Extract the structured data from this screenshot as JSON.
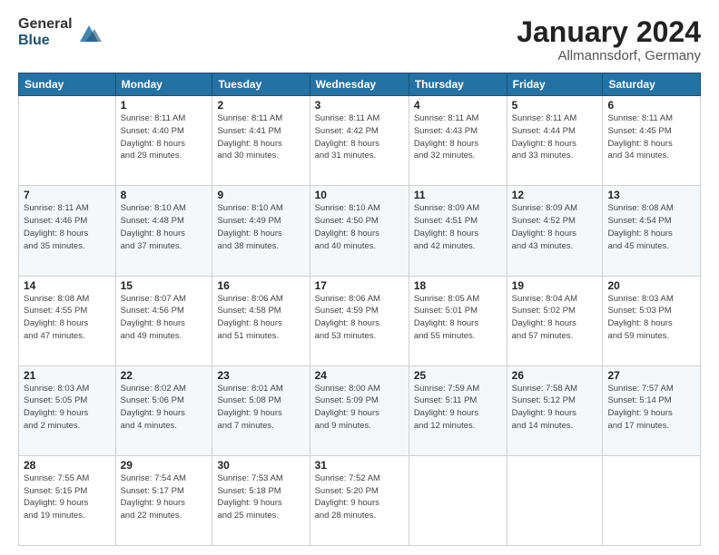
{
  "logo": {
    "general": "General",
    "blue": "Blue"
  },
  "header": {
    "title": "January 2024",
    "location": "Allmannsdorf, Germany"
  },
  "days_of_week": [
    "Sunday",
    "Monday",
    "Tuesday",
    "Wednesday",
    "Thursday",
    "Friday",
    "Saturday"
  ],
  "weeks": [
    [
      {
        "day": "",
        "sunrise": "",
        "sunset": "",
        "daylight": ""
      },
      {
        "day": "1",
        "sunrise": "Sunrise: 8:11 AM",
        "sunset": "Sunset: 4:40 PM",
        "daylight": "Daylight: 8 hours and 29 minutes."
      },
      {
        "day": "2",
        "sunrise": "Sunrise: 8:11 AM",
        "sunset": "Sunset: 4:41 PM",
        "daylight": "Daylight: 8 hours and 30 minutes."
      },
      {
        "day": "3",
        "sunrise": "Sunrise: 8:11 AM",
        "sunset": "Sunset: 4:42 PM",
        "daylight": "Daylight: 8 hours and 31 minutes."
      },
      {
        "day": "4",
        "sunrise": "Sunrise: 8:11 AM",
        "sunset": "Sunset: 4:43 PM",
        "daylight": "Daylight: 8 hours and 32 minutes."
      },
      {
        "day": "5",
        "sunrise": "Sunrise: 8:11 AM",
        "sunset": "Sunset: 4:44 PM",
        "daylight": "Daylight: 8 hours and 33 minutes."
      },
      {
        "day": "6",
        "sunrise": "Sunrise: 8:11 AM",
        "sunset": "Sunset: 4:45 PM",
        "daylight": "Daylight: 8 hours and 34 minutes."
      }
    ],
    [
      {
        "day": "7",
        "sunrise": "Sunrise: 8:11 AM",
        "sunset": "Sunset: 4:46 PM",
        "daylight": "Daylight: 8 hours and 35 minutes."
      },
      {
        "day": "8",
        "sunrise": "Sunrise: 8:10 AM",
        "sunset": "Sunset: 4:48 PM",
        "daylight": "Daylight: 8 hours and 37 minutes."
      },
      {
        "day": "9",
        "sunrise": "Sunrise: 8:10 AM",
        "sunset": "Sunset: 4:49 PM",
        "daylight": "Daylight: 8 hours and 38 minutes."
      },
      {
        "day": "10",
        "sunrise": "Sunrise: 8:10 AM",
        "sunset": "Sunset: 4:50 PM",
        "daylight": "Daylight: 8 hours and 40 minutes."
      },
      {
        "day": "11",
        "sunrise": "Sunrise: 8:09 AM",
        "sunset": "Sunset: 4:51 PM",
        "daylight": "Daylight: 8 hours and 42 minutes."
      },
      {
        "day": "12",
        "sunrise": "Sunrise: 8:09 AM",
        "sunset": "Sunset: 4:52 PM",
        "daylight": "Daylight: 8 hours and 43 minutes."
      },
      {
        "day": "13",
        "sunrise": "Sunrise: 8:08 AM",
        "sunset": "Sunset: 4:54 PM",
        "daylight": "Daylight: 8 hours and 45 minutes."
      }
    ],
    [
      {
        "day": "14",
        "sunrise": "Sunrise: 8:08 AM",
        "sunset": "Sunset: 4:55 PM",
        "daylight": "Daylight: 8 hours and 47 minutes."
      },
      {
        "day": "15",
        "sunrise": "Sunrise: 8:07 AM",
        "sunset": "Sunset: 4:56 PM",
        "daylight": "Daylight: 8 hours and 49 minutes."
      },
      {
        "day": "16",
        "sunrise": "Sunrise: 8:06 AM",
        "sunset": "Sunset: 4:58 PM",
        "daylight": "Daylight: 8 hours and 51 minutes."
      },
      {
        "day": "17",
        "sunrise": "Sunrise: 8:06 AM",
        "sunset": "Sunset: 4:59 PM",
        "daylight": "Daylight: 8 hours and 53 minutes."
      },
      {
        "day": "18",
        "sunrise": "Sunrise: 8:05 AM",
        "sunset": "Sunset: 5:01 PM",
        "daylight": "Daylight: 8 hours and 55 minutes."
      },
      {
        "day": "19",
        "sunrise": "Sunrise: 8:04 AM",
        "sunset": "Sunset: 5:02 PM",
        "daylight": "Daylight: 8 hours and 57 minutes."
      },
      {
        "day": "20",
        "sunrise": "Sunrise: 8:03 AM",
        "sunset": "Sunset: 5:03 PM",
        "daylight": "Daylight: 8 hours and 59 minutes."
      }
    ],
    [
      {
        "day": "21",
        "sunrise": "Sunrise: 8:03 AM",
        "sunset": "Sunset: 5:05 PM",
        "daylight": "Daylight: 9 hours and 2 minutes."
      },
      {
        "day": "22",
        "sunrise": "Sunrise: 8:02 AM",
        "sunset": "Sunset: 5:06 PM",
        "daylight": "Daylight: 9 hours and 4 minutes."
      },
      {
        "day": "23",
        "sunrise": "Sunrise: 8:01 AM",
        "sunset": "Sunset: 5:08 PM",
        "daylight": "Daylight: 9 hours and 7 minutes."
      },
      {
        "day": "24",
        "sunrise": "Sunrise: 8:00 AM",
        "sunset": "Sunset: 5:09 PM",
        "daylight": "Daylight: 9 hours and 9 minutes."
      },
      {
        "day": "25",
        "sunrise": "Sunrise: 7:59 AM",
        "sunset": "Sunset: 5:11 PM",
        "daylight": "Daylight: 9 hours and 12 minutes."
      },
      {
        "day": "26",
        "sunrise": "Sunrise: 7:58 AM",
        "sunset": "Sunset: 5:12 PM",
        "daylight": "Daylight: 9 hours and 14 minutes."
      },
      {
        "day": "27",
        "sunrise": "Sunrise: 7:57 AM",
        "sunset": "Sunset: 5:14 PM",
        "daylight": "Daylight: 9 hours and 17 minutes."
      }
    ],
    [
      {
        "day": "28",
        "sunrise": "Sunrise: 7:55 AM",
        "sunset": "Sunset: 5:15 PM",
        "daylight": "Daylight: 9 hours and 19 minutes."
      },
      {
        "day": "29",
        "sunrise": "Sunrise: 7:54 AM",
        "sunset": "Sunset: 5:17 PM",
        "daylight": "Daylight: 9 hours and 22 minutes."
      },
      {
        "day": "30",
        "sunrise": "Sunrise: 7:53 AM",
        "sunset": "Sunset: 5:18 PM",
        "daylight": "Daylight: 9 hours and 25 minutes."
      },
      {
        "day": "31",
        "sunrise": "Sunrise: 7:52 AM",
        "sunset": "Sunset: 5:20 PM",
        "daylight": "Daylight: 9 hours and 28 minutes."
      },
      {
        "day": "",
        "sunrise": "",
        "sunset": "",
        "daylight": ""
      },
      {
        "day": "",
        "sunrise": "",
        "sunset": "",
        "daylight": ""
      },
      {
        "day": "",
        "sunrise": "",
        "sunset": "",
        "daylight": ""
      }
    ]
  ]
}
